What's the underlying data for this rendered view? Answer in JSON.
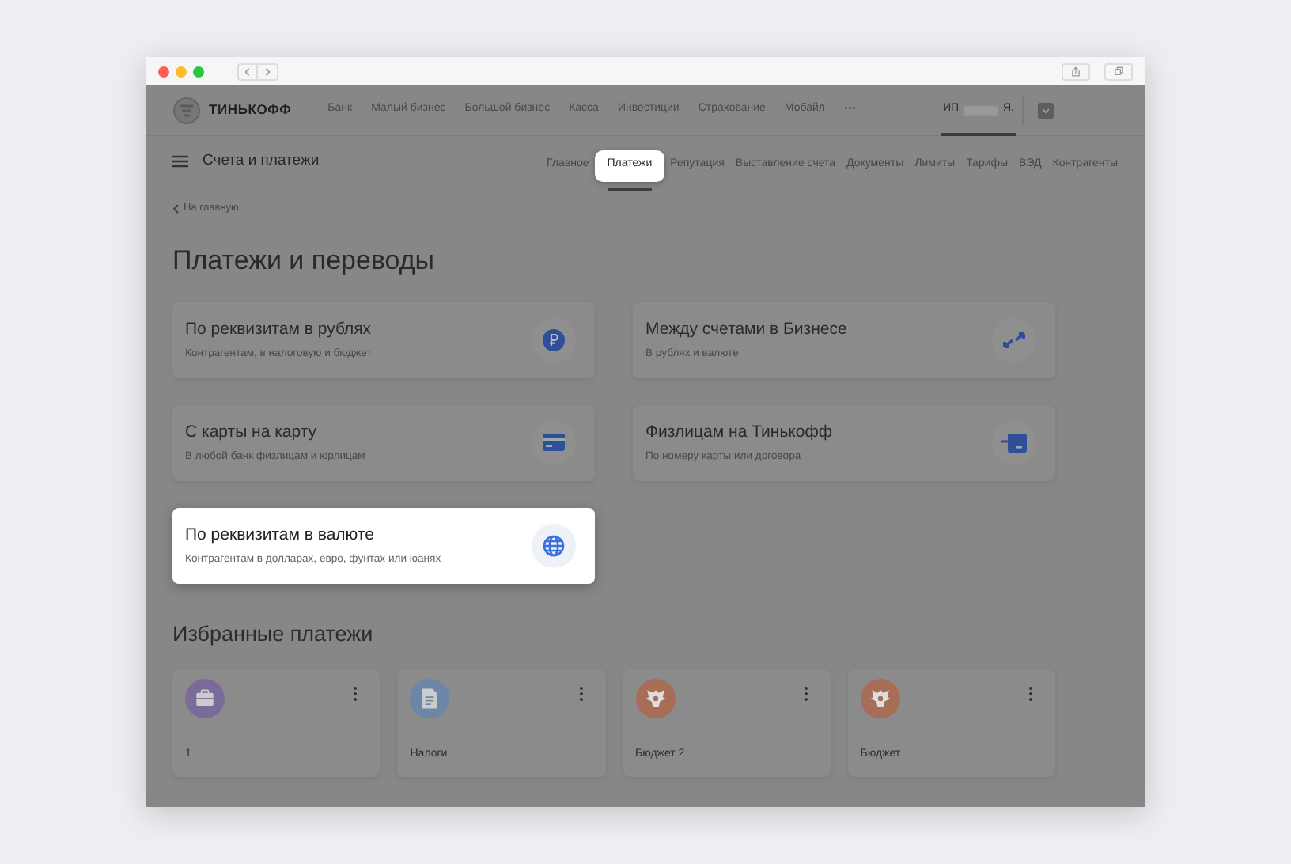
{
  "top_nav": {
    "brand": "ТИНЬКОФФ",
    "items": [
      "Банк",
      "Малый бизнес",
      "Большой бизнес",
      "Касса",
      "Инвестиции",
      "Страхование",
      "Мобайл"
    ],
    "more": "···",
    "account_prefix": "ИП",
    "account_suffix": "Я."
  },
  "section_bar": {
    "title": "Счета и платежи",
    "tabs": [
      {
        "label": "Главное",
        "selected": false,
        "spotlight": false
      },
      {
        "label": "Платежи",
        "selected": true,
        "spotlight": true
      },
      {
        "label": "Репутация",
        "selected": false,
        "spotlight": false
      },
      {
        "label": "Выставление счета",
        "selected": false,
        "spotlight": false
      },
      {
        "label": "Документы",
        "selected": false,
        "spotlight": false
      },
      {
        "label": "Лимиты",
        "selected": false,
        "spotlight": false
      },
      {
        "label": "Тарифы",
        "selected": false,
        "spotlight": false
      },
      {
        "label": "ВЭД",
        "selected": false,
        "spotlight": false
      },
      {
        "label": "Контрагенты",
        "selected": false,
        "spotlight": false
      }
    ]
  },
  "back_link": "На главную",
  "heading": "Платежи и переводы",
  "payment_options": [
    {
      "title": "По реквизитам в рублях",
      "subtitle": "Контрагентам, в налоговую и бюджет",
      "kind": "ruble",
      "spotlight": false
    },
    {
      "title": "Между счетами в Бизнесе",
      "subtitle": "В рублях и валюте",
      "kind": "transfer",
      "spotlight": false
    },
    {
      "title": "С карты на карту",
      "subtitle": "В любой банк физлицам и юрлицам",
      "kind": "card",
      "spotlight": false
    },
    {
      "title": "Физлицам на Тинькофф",
      "subtitle": "По номеру карты или договора",
      "kind": "incoming",
      "spotlight": false
    },
    {
      "title": "По реквизитам в валюте",
      "subtitle": "Контрагентам в долларах, евро, фунтах или юанях",
      "kind": "globe",
      "spotlight": true
    }
  ],
  "favorites_heading": "Избранные платежи",
  "favorites": [
    {
      "label": "1",
      "kind": "briefcase",
      "color": "#7b6b9b"
    },
    {
      "label": "Налоги",
      "kind": "document",
      "color": "#6b86a6"
    },
    {
      "label": "Бюджет 2",
      "kind": "emblem",
      "color": "#a86d56"
    },
    {
      "label": "Бюджет",
      "kind": "emblem",
      "color": "#a86d56"
    }
  ]
}
